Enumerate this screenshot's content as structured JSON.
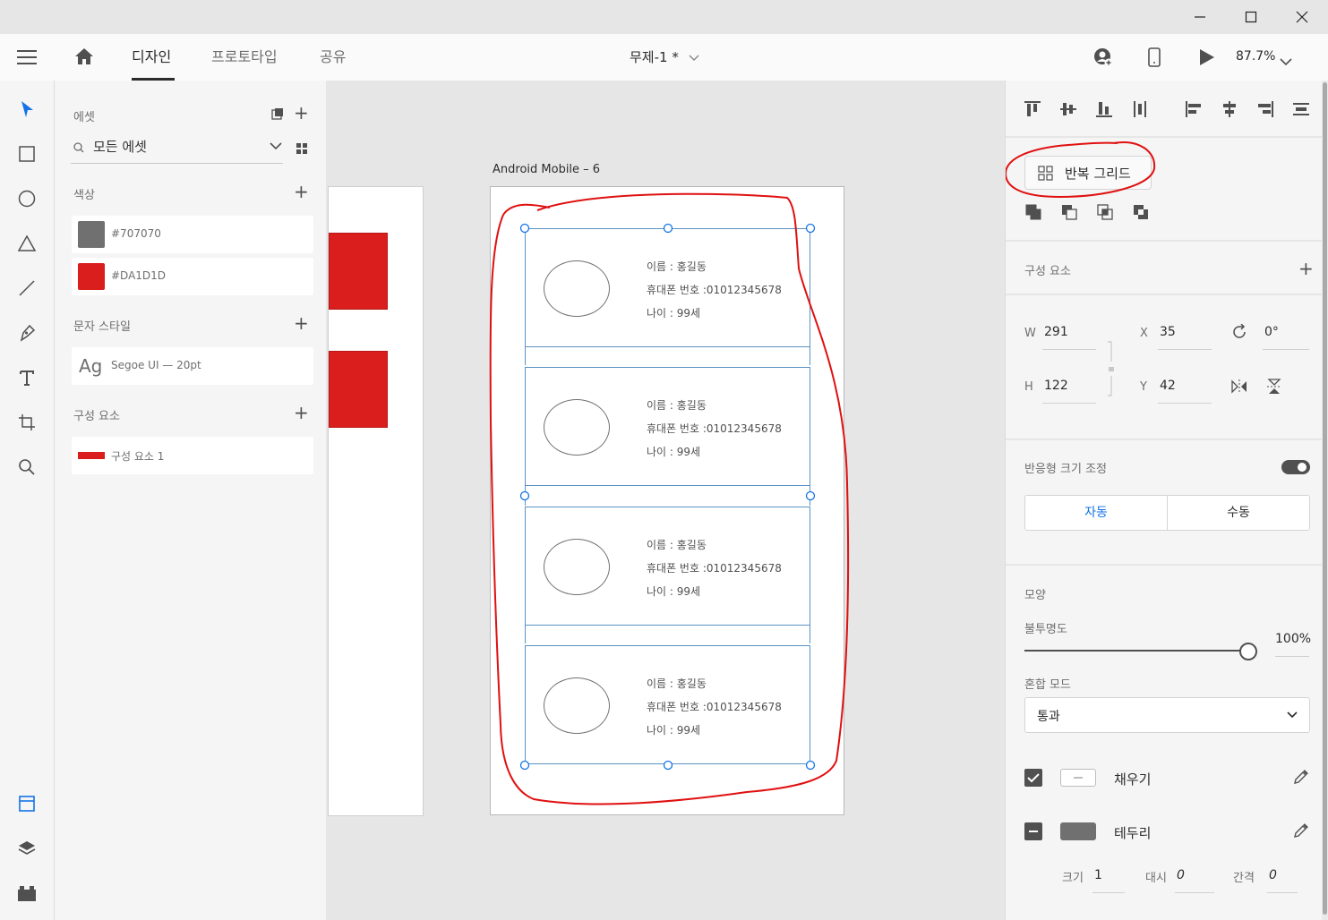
{
  "window": {
    "minimize": "—",
    "maximize": "☐",
    "close": "✕"
  },
  "appbar": {
    "tabs": [
      {
        "label": "디자인",
        "active": true
      },
      {
        "label": "프로토타입",
        "active": false
      },
      {
        "label": "공유",
        "active": false
      }
    ],
    "doc_title": "무제-1 *",
    "zoom": "87.7%"
  },
  "assets": {
    "title": "에셋",
    "search_placeholder": "모든 에셋",
    "colors_title": "색상",
    "colors": [
      {
        "hex": "#707070",
        "label": "#707070"
      },
      {
        "hex": "#DA1D1D",
        "label": "#DA1D1D"
      }
    ],
    "char_styles_title": "문자 스타일",
    "char_style": {
      "preview": "Ag",
      "label": "Segoe UI — 20pt"
    },
    "components_title": "구성 요소",
    "component": {
      "label": "구성 요소 1"
    }
  },
  "canvas": {
    "artboard_title": "Android Mobile – 6",
    "cards": [
      {
        "name": "이름 : 홍길동",
        "phone": "휴대폰 번호 :01012345678",
        "age": "나이 : 99세"
      },
      {
        "name": "이름 : 홍길동",
        "phone": "휴대폰 번호 :01012345678",
        "age": "나이 : 99세"
      },
      {
        "name": "이름 : 홍길동",
        "phone": "휴대폰 번호 :01012345678",
        "age": "나이 : 99세"
      },
      {
        "name": "이름 : 홍길동",
        "phone": "휴대폰 번호 :01012345678",
        "age": "나이 : 99세"
      }
    ],
    "annotation_color": "#e01010",
    "selection_color": "#1473e6"
  },
  "props": {
    "repeat_grid": "반복 그리드",
    "components_title": "구성 요소",
    "w_label": "W",
    "w": "291",
    "h_label": "H",
    "h": "122",
    "x_label": "X",
    "x": "35",
    "y_label": "Y",
    "y": "42",
    "rotation": "0°",
    "responsive_title": "반응형 크기 조정",
    "responsive_enabled": true,
    "seg_auto": "자동",
    "seg_manual": "수동",
    "appearance_title": "모양",
    "opacity_label": "불투명도",
    "opacity": "100%",
    "blend_label": "혼합 모드",
    "blend_value": "통과",
    "fill_label": "채우기",
    "fill_enabled": true,
    "border_label": "테두리",
    "border_color": "#707070",
    "size_label": "크기",
    "size": "1",
    "dash_label": "대시",
    "dash": "0",
    "gap_label": "간격",
    "gap": "0"
  }
}
